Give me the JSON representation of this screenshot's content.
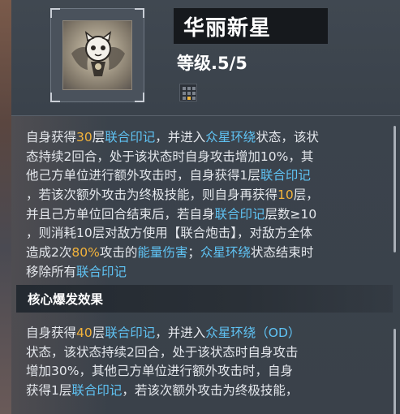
{
  "header": {
    "title": "华丽新星",
    "level": "等级.5/5"
  },
  "icons": {
    "skill_icon": "mascot-emblem-icon",
    "type_icon": "grid-dots-icon",
    "highlight_color": "#f0b63c"
  },
  "colors": {
    "keyword_blue": "#5fc3f4",
    "number_orange": "#f3b33b"
  },
  "description": {
    "lines": [
      [
        {
          "t": "自身获得",
          "c": ""
        },
        {
          "t": "30",
          "c": "orange"
        },
        {
          "t": "层",
          "c": ""
        },
        {
          "t": "联合印记",
          "c": "blue"
        },
        {
          "t": "，并进入",
          "c": ""
        },
        {
          "t": "众星环绕",
          "c": "blue"
        },
        {
          "t": "状态，该状",
          "c": ""
        }
      ],
      [
        {
          "t": "态持续2回合，处于该状态时自身攻击增加10%，其",
          "c": ""
        }
      ],
      [
        {
          "t": "他己方单位进行额外攻击时，自身获得1层",
          "c": ""
        },
        {
          "t": "联合印记",
          "c": "blue"
        }
      ],
      [
        {
          "t": "，若该次额外攻击为终极技能，则自身再获得",
          "c": ""
        },
        {
          "t": "10",
          "c": "orange"
        },
        {
          "t": "层，",
          "c": ""
        }
      ],
      [
        {
          "t": "并且己方单位回合结束后，若自身",
          "c": ""
        },
        {
          "t": "联合印记",
          "c": "blue"
        },
        {
          "t": "层数≥10",
          "c": ""
        }
      ],
      [
        {
          "t": "，则消耗10层对敌方使用【联合炮击】，对敌方全体",
          "c": ""
        }
      ],
      [
        {
          "t": "造成2次",
          "c": ""
        },
        {
          "t": "80%",
          "c": "orange"
        },
        {
          "t": "攻击的",
          "c": ""
        },
        {
          "t": "能量伤害",
          "c": "blue"
        },
        {
          "t": "；",
          "c": ""
        },
        {
          "t": "众星环绕",
          "c": "blue"
        },
        {
          "t": "状态结束时",
          "c": ""
        }
      ],
      [
        {
          "t": "移除所有",
          "c": ""
        },
        {
          "t": "联合印记",
          "c": "blue"
        }
      ]
    ]
  },
  "core": {
    "title": "核心爆发效果",
    "lines": [
      [
        {
          "t": "自身获得",
          "c": ""
        },
        {
          "t": "40",
          "c": "orange"
        },
        {
          "t": "层",
          "c": ""
        },
        {
          "t": "联合印记",
          "c": "blue"
        },
        {
          "t": "，并进入",
          "c": ""
        },
        {
          "t": "众星环绕（OD）",
          "c": "blue"
        }
      ],
      [
        {
          "t": "状态，该状态持续2回合，处于该状态时自身攻击",
          "c": ""
        }
      ],
      [
        {
          "t": "增加30%，其他己方单位进行额外攻击时，自身",
          "c": ""
        }
      ],
      [
        {
          "t": "获得1层",
          "c": ""
        },
        {
          "t": "联合印记",
          "c": "blue"
        },
        {
          "t": "，若该次额外攻击为终极技能，",
          "c": ""
        }
      ]
    ]
  }
}
